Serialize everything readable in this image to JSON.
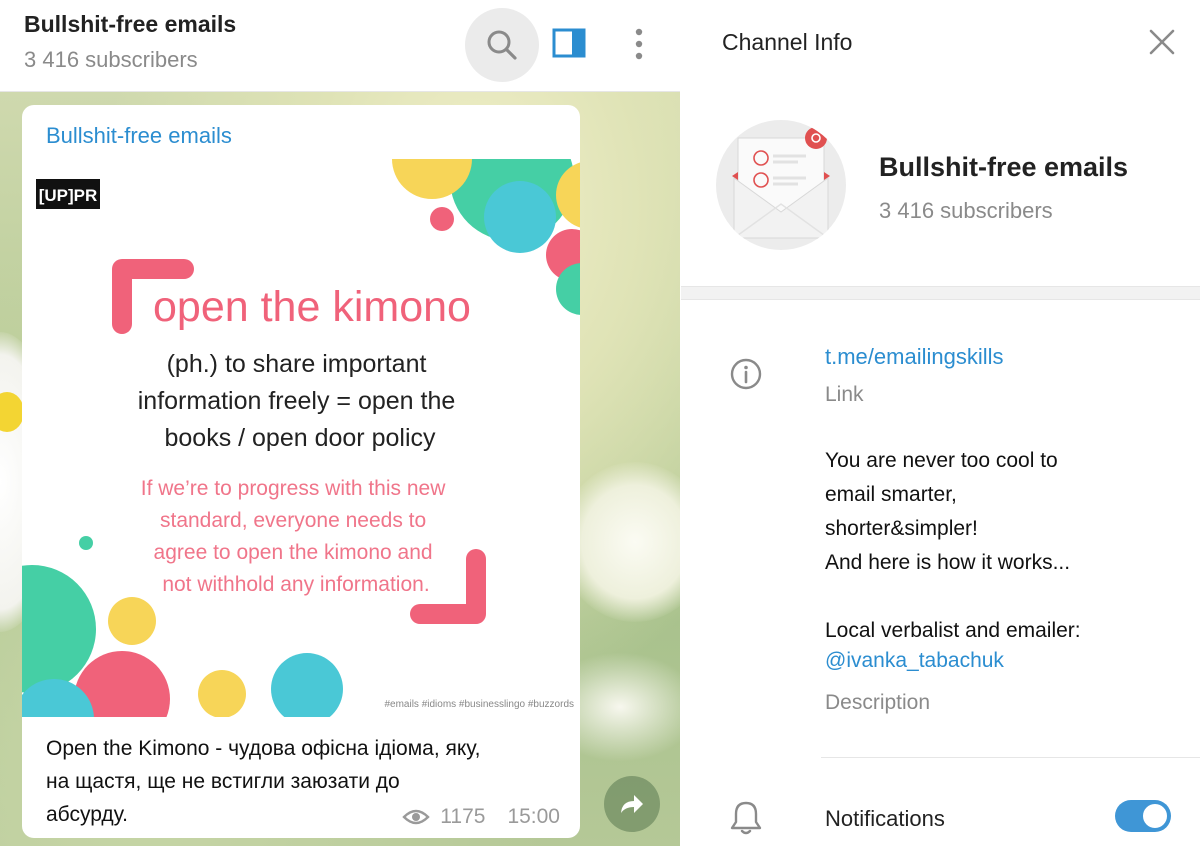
{
  "chat": {
    "title": "Bullshit-free emails",
    "subscribers": "3 416 subscribers"
  },
  "message": {
    "author": "Bullshit-free emails",
    "image": {
      "logo": "[UP]PR",
      "headline": "open the kimono",
      "definition_lines": [
        "(ph.) to share important",
        "information freely = open the",
        "books / open door policy"
      ],
      "example_lines": [
        "If we’re to progress with this new",
        "standard, everyone needs to",
        "agree to open the kimono and",
        "not withhold any information."
      ],
      "hashtags": "#emails #idioms #businesslingo #buzzords"
    },
    "caption": "Open the Kimono - чудова офісна ідіома, яку,\nна щастя, ще не встигли заюзати до\nабсурду.",
    "views": "1175",
    "time": "15:00"
  },
  "info": {
    "title": "Channel Info",
    "channel_name": "Bullshit-free emails",
    "subscribers": "3 416 subscribers",
    "link": "t.me/emailingskills",
    "link_label": "Link",
    "description": "You are never too cool to\nemail smarter,\nshorter&simpler!\nAnd here is how it works...\n\nLocal verbalist and emailer:",
    "description_mention": "@ivanka_tabachuk",
    "description_label": "Description",
    "notifications_label": "Notifications",
    "notifications_on": true
  },
  "colors": {
    "accent": "#2b8dd0",
    "toggle": "#3f96d6",
    "pink": "#f0627a",
    "teal": "#45cfa5",
    "yellow": "#f7d558"
  },
  "icons": [
    "search-icon",
    "side-panel-icon",
    "more-vertical-icon",
    "eye-icon",
    "forward-icon",
    "close-icon",
    "info-icon",
    "bell-icon",
    "envelope-icon"
  ]
}
